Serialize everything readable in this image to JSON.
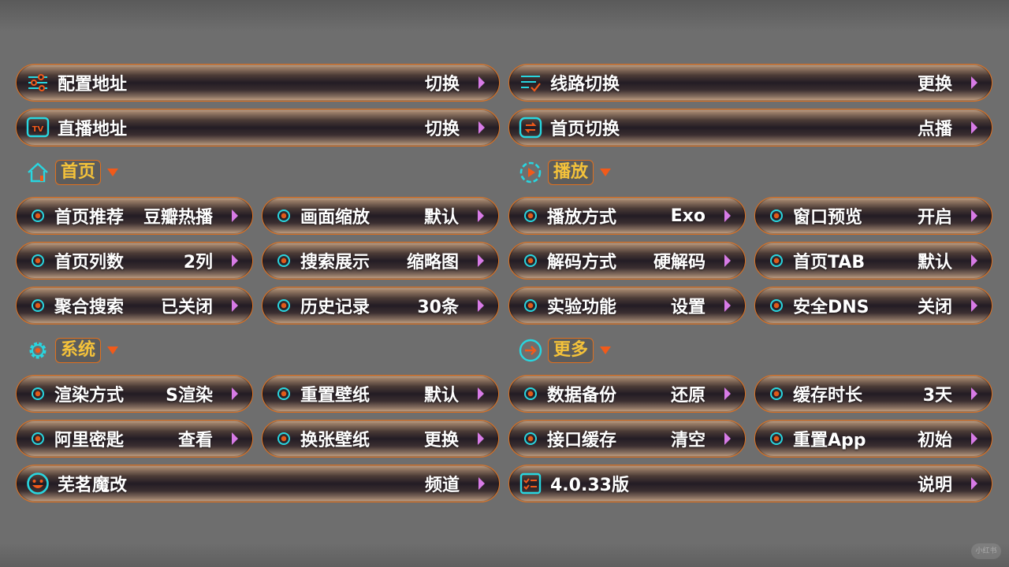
{
  "top": [
    {
      "label": "配置地址",
      "value": "切换",
      "icon": "sliders-icon"
    },
    {
      "label": "线路切换",
      "value": "更换",
      "icon": "list-check-icon"
    },
    {
      "label": "直播地址",
      "value": "切换",
      "icon": "tv-icon"
    },
    {
      "label": "首页切换",
      "value": "点播",
      "icon": "swap-icon"
    }
  ],
  "sections": {
    "home": {
      "title": "首页",
      "icon": "home-icon"
    },
    "play": {
      "title": "播放",
      "icon": "play-circle-icon"
    },
    "system": {
      "title": "系统",
      "icon": "gear-icon"
    },
    "more": {
      "title": "更多",
      "icon": "arrow-right-circle-icon"
    }
  },
  "home_items": [
    {
      "label": "首页推荐",
      "value": "豆瓣热播"
    },
    {
      "label": "画面缩放",
      "value": "默认"
    },
    {
      "label": "首页列数",
      "value": "2列"
    },
    {
      "label": "搜索展示",
      "value": "缩略图"
    },
    {
      "label": "聚合搜索",
      "value": "已关闭"
    },
    {
      "label": "历史记录",
      "value": "30条"
    }
  ],
  "play_items": [
    {
      "label": "播放方式",
      "value": "Exo"
    },
    {
      "label": "窗口预览",
      "value": "开启"
    },
    {
      "label": "解码方式",
      "value": "硬解码"
    },
    {
      "label": "首页TAB",
      "value": "默认"
    },
    {
      "label": "实验功能",
      "value": "设置"
    },
    {
      "label": "安全DNS",
      "value": "关闭"
    }
  ],
  "system_items": [
    {
      "label": "渲染方式",
      "value": "S渲染"
    },
    {
      "label": "重置壁纸",
      "value": "默认"
    },
    {
      "label": "阿里密匙",
      "value": "查看"
    },
    {
      "label": "换张壁纸",
      "value": "更换"
    }
  ],
  "more_items": [
    {
      "label": "数据备份",
      "value": "还原"
    },
    {
      "label": "缓存时长",
      "value": "3天"
    },
    {
      "label": "接口缓存",
      "value": "清空"
    },
    {
      "label": "重置App",
      "value": "初始"
    }
  ],
  "bottom": [
    {
      "label": "芜茗魔改",
      "value": "频道",
      "icon": "smiley-icon"
    },
    {
      "label": "4.0.33版",
      "value": "说明",
      "icon": "checklist-icon"
    }
  ],
  "watermark": "小红书",
  "colors": {
    "accent": "#e0701e",
    "cyan": "#28d6e0",
    "title": "#f4c23a",
    "chevron": "#d77be6"
  }
}
